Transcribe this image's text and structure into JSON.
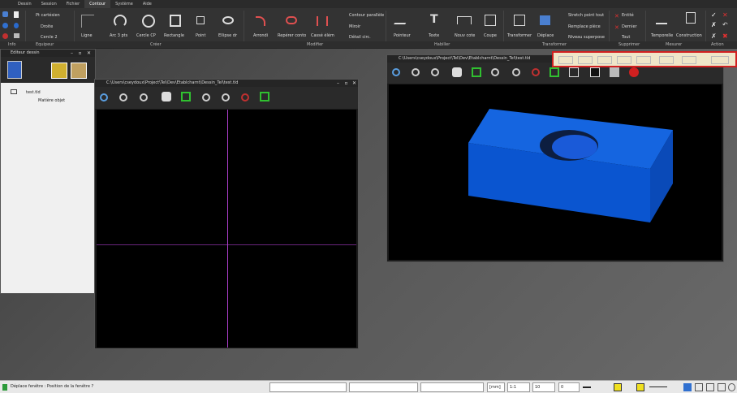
{
  "menu": [
    "Dessin",
    "Session",
    "Fichier",
    "Contour",
    "Système",
    "Aide"
  ],
  "menu_active_index": 3,
  "ribbon": {
    "small_left": [
      "Pt cartésien",
      "Droite",
      "Cercle 2"
    ],
    "big_buttons": [
      "Ligne",
      "Arc 3 pts",
      "Cercle CP",
      "Rectangle",
      "Point",
      "Ellipse dr",
      "Arrondi",
      "Repérer conto",
      "Cassé élém",
      "Pointeur",
      "Texte",
      "Nouv cote",
      "Coupe",
      "Transformer",
      "Déplace",
      "Temporelle",
      "Construction"
    ],
    "modify_small": [
      "Contour parallèle",
      "Miroir",
      "Détail circ."
    ],
    "transform_small": [
      "Stretch point tout",
      "Remplace pièce",
      "Niveau superpose"
    ],
    "delete_small": [
      "Entité",
      "Dernier",
      "Tout"
    ],
    "groups": [
      "Info",
      "Equipeur",
      "Créer",
      "Modifier",
      "Habiller",
      "Transformer",
      "Supprimer",
      "Mesurer",
      "Action"
    ]
  },
  "drawing_editor": {
    "title": "Editeur dessin",
    "tree_root": "test.tld",
    "tree_child": "Matière objet"
  },
  "window_2d": {
    "title": "C:\\Users\\cseydoux\\Project\\Tel\\Dev\\Etablcharnt\\Dessin_Tel\\test.tld"
  },
  "window_3d": {
    "title": "C:\\Users\\cseydoux\\Project\\Tel\\Dev\\Etablcharnt\\Dessin_Tel\\test.tld"
  },
  "status": {
    "message": "Déplace fenêtre : Position de la fenêtre ?",
    "unit": "[mm]",
    "scale": "1:1",
    "step": "10",
    "count": "0"
  },
  "colors": {
    "box_top": "#1565e0",
    "box_front": "#0a55d0",
    "box_side": "#0a4ab8",
    "crosshair": "#b040d0",
    "status_green": "#2c9a3a"
  }
}
